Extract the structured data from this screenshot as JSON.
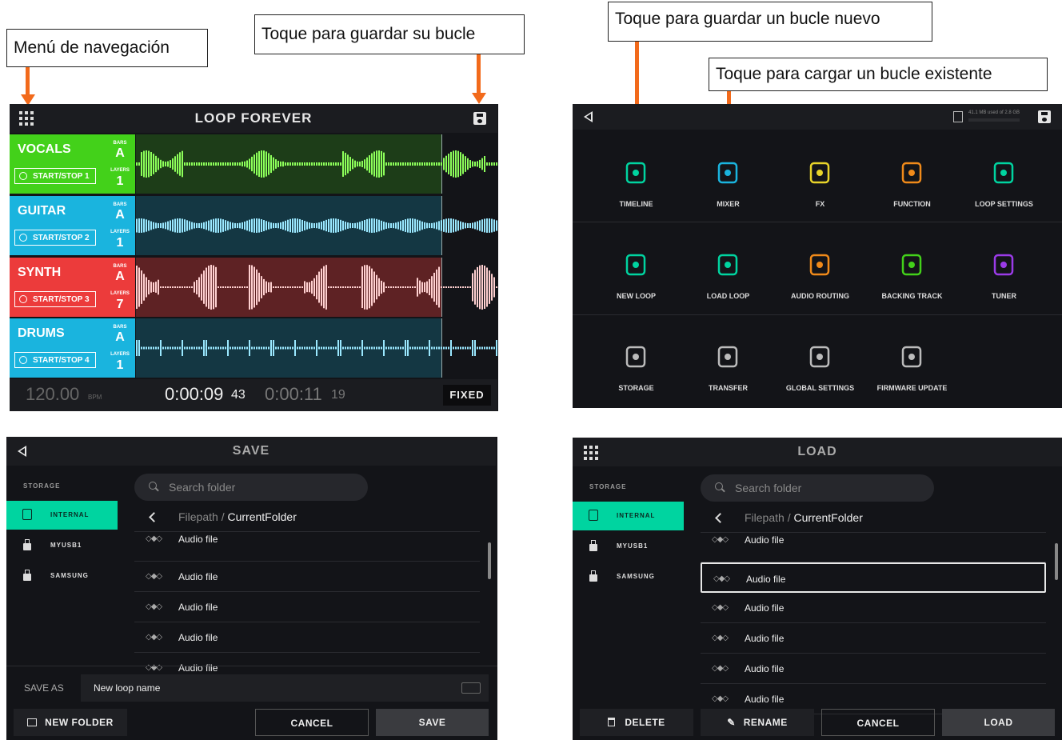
{
  "callouts": {
    "nav_menu": "Menú de navegación",
    "save_loop": "Toque para guardar su bucle",
    "save_new": "Toque para guardar un bucle nuevo",
    "load_existing": "Toque para cargar un bucle existente"
  },
  "loop_screen": {
    "title": "LOOP FOREVER",
    "bars_label": "BARS",
    "layers_label": "LAYERS",
    "tracks": [
      {
        "name": "VOCALS",
        "button": "START/STOP 1",
        "bars": "A",
        "layers": "1",
        "color": "#43d11a"
      },
      {
        "name": "GUITAR",
        "button": "START/STOP 2",
        "bars": "A",
        "layers": "1",
        "color": "#1ab4de"
      },
      {
        "name": "SYNTH",
        "button": "START/STOP 3",
        "bars": "A",
        "layers": "7",
        "color": "#ec3b3b"
      },
      {
        "name": "DRUMS",
        "button": "START/STOP 4",
        "bars": "A",
        "layers": "1",
        "color": "#1ab4de"
      }
    ],
    "bpm": "120.00",
    "bpm_unit": "BPM",
    "time_current": "0:00:09",
    "time_current_sub": "43",
    "time_total": "0:00:11",
    "time_total_sub": "19",
    "mode": "FIXED"
  },
  "menu_screen": {
    "storage_text": "41.1 MB used of 2.8 GB",
    "tiles": [
      {
        "label": "TIMELINE",
        "icon": "timeline-icon",
        "color": "#00d4a0"
      },
      {
        "label": "MIXER",
        "icon": "mixer-icon",
        "color": "#1ab4de"
      },
      {
        "label": "FX",
        "icon": "fx-icon",
        "color": "#e8d42a"
      },
      {
        "label": "FUNCTION",
        "icon": "function-icon",
        "color": "#f08a1a"
      },
      {
        "label": "LOOP SETTINGS",
        "icon": "loop-settings-icon",
        "color": "#00d4a0"
      },
      {
        "label": "NEW LOOP",
        "icon": "new-loop-icon",
        "color": "#00d4a0"
      },
      {
        "label": "LOAD LOOP",
        "icon": "load-loop-icon",
        "color": "#00d4a0"
      },
      {
        "label": "AUDIO ROUTING",
        "icon": "audio-routing-icon",
        "color": "#f08a1a"
      },
      {
        "label": "BACKING TRACK",
        "icon": "backing-track-icon",
        "color": "#43d11a"
      },
      {
        "label": "TUNER",
        "icon": "tuner-icon",
        "color": "#9b3be8"
      },
      {
        "label": "STORAGE",
        "icon": "storage-icon",
        "color": "#bbbbbb"
      },
      {
        "label": "TRANSFER",
        "icon": "transfer-icon",
        "color": "#bbbbbb"
      },
      {
        "label": "GLOBAL SETTINGS",
        "icon": "global-settings-icon",
        "color": "#bbbbbb"
      },
      {
        "label": "FIRMWARE UPDATE",
        "icon": "firmware-update-icon",
        "color": "#bbbbbb"
      }
    ]
  },
  "save_screen": {
    "title": "SAVE",
    "storage_heading": "STORAGE",
    "drives": [
      "INTERNAL",
      "MYUSB1",
      "SAMSUNG"
    ],
    "search_placeholder": "Search folder",
    "path_prefix": "Filepath / ",
    "path_current": "CurrentFolder",
    "files": [
      "Audio file",
      "Audio file",
      "Audio file",
      "Audio file",
      "Audio file"
    ],
    "save_as_label": "SAVE AS",
    "save_as_value": "New loop name",
    "new_folder": "NEW FOLDER",
    "cancel": "CANCEL",
    "save": "SAVE"
  },
  "load_screen": {
    "title": "LOAD",
    "storage_heading": "STORAGE",
    "drives": [
      "INTERNAL",
      "MYUSB1",
      "SAMSUNG"
    ],
    "search_placeholder": "Search folder",
    "path_prefix": "Filepath / ",
    "path_current": "CurrentFolder",
    "files": [
      "Audio file",
      "Audio file",
      "Audio file",
      "Audio file",
      "Audio file",
      "Audio file"
    ],
    "delete": "DELETE",
    "rename": "RENAME",
    "cancel": "CANCEL",
    "load": "LOAD"
  },
  "colors": {
    "arrow": "#f26a1b",
    "accent": "#00d4a0"
  }
}
